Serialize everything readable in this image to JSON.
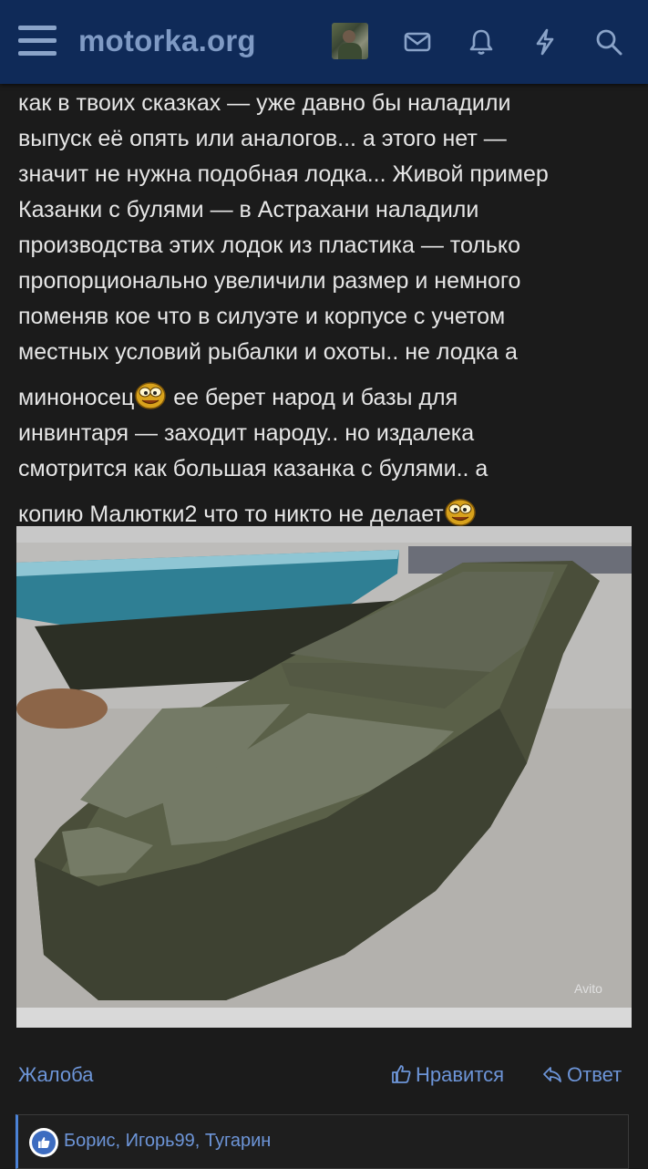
{
  "header": {
    "site_name": "motorka.org",
    "icons": [
      "menu-icon",
      "avatar",
      "inbox-icon",
      "bell-icon",
      "lightning-icon",
      "search-icon"
    ]
  },
  "post": {
    "lines": [
      "как в твоих сказках — уже давно бы наладили",
      "выпуск её опять или аналогов... а этого нет —",
      "значит не нужна подобная лодка... Живой пример",
      "Казанки с булями — в Астрахани наладили",
      "производства этих лодок из пластика — только",
      "пропорционально увеличили размер и немного",
      "поменяв кое что в силуэте и корпусе с учетом",
      "местных условий рыбалки и охоты.. не лодка а"
    ],
    "line9_before": "миноносец",
    "line9_after": " ее берет народ и базы для",
    "line10": "инвинтаря — заходит народу.. но издалека",
    "line11": "смотрится как большая казанка с булями.. а",
    "line12": "копию Малютки2 что то никто не делает",
    "image_watermark": "Avito"
  },
  "actions": {
    "report": "Жалоба",
    "like": "Нравится",
    "reply": "Ответ"
  },
  "reactions": {
    "names": "Борис, Игорь99, Тугарин"
  },
  "colors": {
    "header_bg": "#0f2a58",
    "link": "#6d95d8",
    "page_bg": "#1b1b1b"
  }
}
